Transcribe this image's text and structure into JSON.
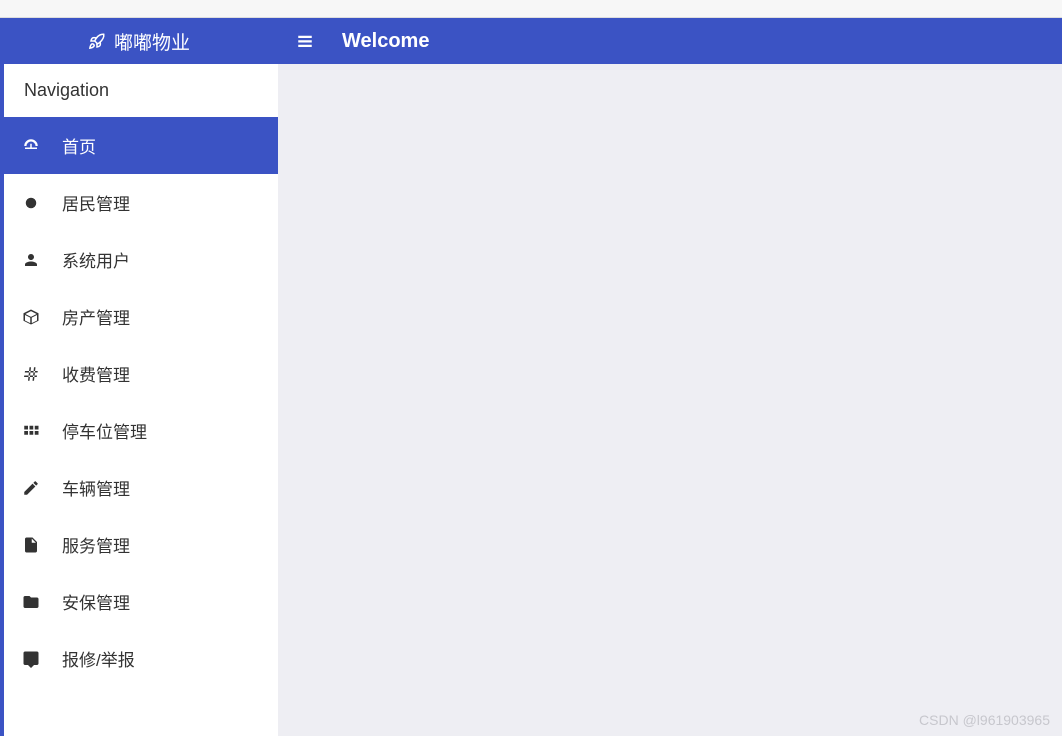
{
  "browser": {
    "url_fragment": ""
  },
  "brand": {
    "title": "嘟嘟物业"
  },
  "sidebar": {
    "nav_header": "Navigation",
    "items": [
      {
        "label": "首页",
        "icon": "dashboard",
        "active": true
      },
      {
        "label": "居民管理",
        "icon": "circle",
        "active": false
      },
      {
        "label": "系统用户",
        "icon": "user",
        "active": false
      },
      {
        "label": "房产管理",
        "icon": "box",
        "active": false
      },
      {
        "label": "收费管理",
        "icon": "hash",
        "active": false
      },
      {
        "label": "停车位管理",
        "icon": "grid",
        "active": false
      },
      {
        "label": "车辆管理",
        "icon": "pencil",
        "active": false
      },
      {
        "label": "服务管理",
        "icon": "file",
        "active": false
      },
      {
        "label": "安保管理",
        "icon": "folder",
        "active": false
      },
      {
        "label": "报修/举报",
        "icon": "comment",
        "active": false
      }
    ]
  },
  "header": {
    "title": "Welcome"
  },
  "watermark": "CSDN @l961903965",
  "colors": {
    "primary": "#3b53c4",
    "sidebar_bg": "#ffffff",
    "content_bg": "#eeeef3"
  }
}
